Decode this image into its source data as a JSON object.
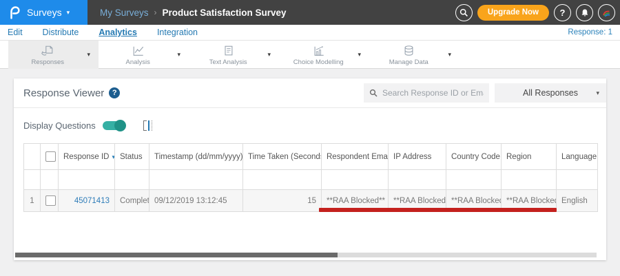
{
  "colors": {
    "brand_blue": "#1e8bea",
    "topbar_dark": "#424242",
    "upgrade_orange": "#f9a41b",
    "nav_blue": "#2479b2",
    "toggle_teal": "#35b0a4",
    "link_blue": "#2e7cb8",
    "annotation_red": "#c4211e",
    "help_badge_blue": "#1c5d8f"
  },
  "icons": {
    "caret_down": "▾",
    "sort_updown": "⇅"
  },
  "topbar": {
    "product_menu": "Surveys",
    "breadcrumb": {
      "parent": "My Surveys",
      "separator": "›",
      "current": "Product Satisfaction Survey"
    },
    "upgrade_label": "Upgrade Now",
    "help_label": "?"
  },
  "nav": {
    "items": [
      {
        "label": "Edit"
      },
      {
        "label": "Distribute"
      },
      {
        "label": "Analytics",
        "active": true
      },
      {
        "label": "Integration"
      }
    ],
    "response_count": "Response: 1"
  },
  "toolbar": {
    "items": [
      {
        "label": "Responses",
        "active": true
      },
      {
        "label": "Analysis"
      },
      {
        "label": "Text Analysis"
      },
      {
        "label": "Choice Modelling"
      },
      {
        "label": "Manage Data"
      }
    ]
  },
  "panel": {
    "title": "Response Viewer",
    "help_label": "?",
    "search_placeholder": "Search Response ID or Email",
    "filter_dropdown_value": "All Responses",
    "display_questions_label": "Display Questions",
    "display_questions_on": true
  },
  "table": {
    "columns": [
      {
        "label": ""
      },
      {
        "label": "",
        "type": "checkbox"
      },
      {
        "label": "Response ID",
        "sort": "desc"
      },
      {
        "label": "Status"
      },
      {
        "label": "Timestamp (dd/mm/yyyy)",
        "sortable": true
      },
      {
        "label": "Time Taken (Seconds)",
        "sortable": true
      },
      {
        "label": "Respondent Email"
      },
      {
        "label": "IP Address"
      },
      {
        "label": "Country Code"
      },
      {
        "label": "Region"
      },
      {
        "label": "Language"
      }
    ],
    "rows": [
      {
        "index": "1",
        "response_id": "45071413",
        "status": "Completed",
        "timestamp": "09/12/2019 13:12:45",
        "time_taken_seconds": "15",
        "respondent_email": "**RAA Blocked**",
        "ip_address": "**RAA Blocked**",
        "country_code": "**RAA Blocked**",
        "region": "**RAA Blocked**",
        "language": "English"
      }
    ]
  }
}
